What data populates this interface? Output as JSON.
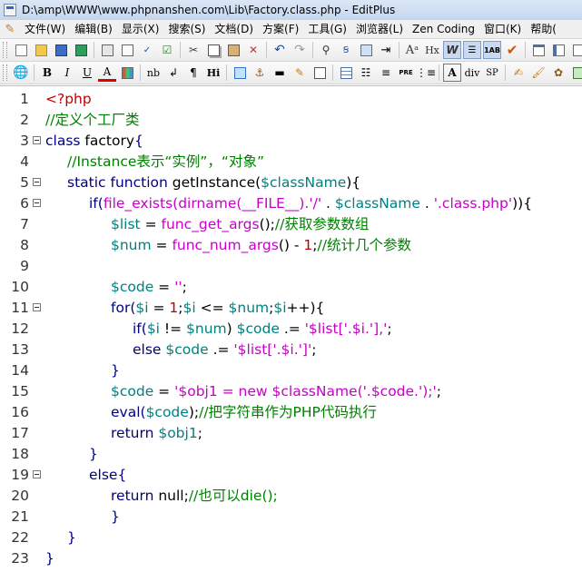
{
  "window": {
    "title": "D:\\amp\\WWW\\www.phpnanshen.com\\Lib\\Factory.class.php - EditPlus"
  },
  "menu": [
    "文件(W)",
    "编辑(B)",
    "显示(X)",
    "搜索(S)",
    "文档(D)",
    "方案(F)",
    "工具(G)",
    "浏览器(L)",
    "Zen Coding",
    "窗口(K)",
    "帮助("
  ],
  "toolbar2": {
    "labels": {
      "bold": "B",
      "italic": "I",
      "underline": "U",
      "fontcolor": "A",
      "nb": "nb",
      "br": "↲",
      "para": "¶",
      "hi": "Hi",
      "pre": "PRE",
      "div": "div",
      "sp": "SP",
      "az": "Aᶻ",
      "hx": "Hx"
    }
  },
  "colors": {
    "keyword": "#000080",
    "variable": "#008080",
    "function": "#c800c8",
    "string": "#c800c8",
    "comment": "#008000",
    "php_tag": "#c00000"
  },
  "lines": [
    {
      "n": "1",
      "fold": false,
      "indent": 0,
      "tokens": [
        [
          "php",
          "<?php"
        ]
      ]
    },
    {
      "n": "2",
      "fold": false,
      "indent": 0,
      "tokens": [
        [
          "cm",
          "//定义个工厂类"
        ]
      ]
    },
    {
      "n": "3",
      "fold": true,
      "indent": 0,
      "tokens": [
        [
          "kw",
          "class "
        ],
        [
          "pl",
          "factory"
        ],
        [
          "kw",
          "{"
        ]
      ]
    },
    {
      "n": "4",
      "fold": false,
      "indent": 1,
      "tokens": [
        [
          "cm",
          "//Instance表示“实例”，“对象”"
        ]
      ]
    },
    {
      "n": "5",
      "fold": true,
      "indent": 1,
      "tokens": [
        [
          "kw",
          "static function "
        ],
        [
          "pl",
          "getInstance("
        ],
        [
          "var",
          "$className"
        ],
        [
          "pl",
          "){"
        ]
      ]
    },
    {
      "n": "6",
      "fold": true,
      "indent": 2,
      "tokens": [
        [
          "kw",
          "if("
        ],
        [
          "fn",
          "file_exists("
        ],
        [
          "fn",
          "dirname("
        ],
        [
          "fn",
          "__FILE__"
        ],
        [
          "fn",
          ")"
        ],
        [
          "str",
          ".'/'"
        ],
        [
          "pl",
          " . "
        ],
        [
          "var",
          "$className"
        ],
        [
          "pl",
          " . "
        ],
        [
          "str",
          "'.class.php'"
        ],
        [
          "pl",
          ")){"
        ]
      ]
    },
    {
      "n": "7",
      "fold": false,
      "indent": 3,
      "tokens": [
        [
          "var",
          "$list"
        ],
        [
          "pl",
          " = "
        ],
        [
          "fn",
          "func_get_args"
        ],
        [
          "pl",
          "();"
        ],
        [
          "cm",
          "//获取参数数组"
        ]
      ]
    },
    {
      "n": "8",
      "fold": false,
      "indent": 3,
      "tokens": [
        [
          "var",
          "$num"
        ],
        [
          "pl",
          " = "
        ],
        [
          "fn",
          "func_num_args"
        ],
        [
          "pl",
          "() - "
        ],
        [
          "num",
          "1"
        ],
        [
          "pl",
          ";"
        ],
        [
          "cm",
          "//统计几个参数"
        ]
      ]
    },
    {
      "n": "9",
      "fold": false,
      "indent": 0,
      "tokens": []
    },
    {
      "n": "10",
      "fold": false,
      "indent": 3,
      "tokens": [
        [
          "var",
          "$code"
        ],
        [
          "pl",
          " = "
        ],
        [
          "str",
          "''"
        ],
        [
          "pl",
          ";"
        ]
      ]
    },
    {
      "n": "11",
      "fold": true,
      "indent": 3,
      "tokens": [
        [
          "kw",
          "for("
        ],
        [
          "var",
          "$i"
        ],
        [
          "pl",
          " = "
        ],
        [
          "num",
          "1"
        ],
        [
          "pl",
          ";"
        ],
        [
          "var",
          "$i"
        ],
        [
          "pl",
          " <= "
        ],
        [
          "var",
          "$num"
        ],
        [
          "pl",
          ";"
        ],
        [
          "var",
          "$i"
        ],
        [
          "pl",
          "++){"
        ]
      ]
    },
    {
      "n": "12",
      "fold": false,
      "indent": 4,
      "tokens": [
        [
          "kw",
          "if("
        ],
        [
          "var",
          "$i"
        ],
        [
          "pl",
          " != "
        ],
        [
          "var",
          "$num"
        ],
        [
          "pl",
          ") "
        ],
        [
          "var",
          "$code"
        ],
        [
          "pl",
          " .= "
        ],
        [
          "str",
          "'$list['.$i.'],'"
        ],
        [
          "pl",
          ";"
        ]
      ]
    },
    {
      "n": "13",
      "fold": false,
      "indent": 4,
      "tokens": [
        [
          "kw",
          "else "
        ],
        [
          "var",
          "$code"
        ],
        [
          "pl",
          " .= "
        ],
        [
          "str",
          "'$list['.$i.']'"
        ],
        [
          "pl",
          ";"
        ]
      ]
    },
    {
      "n": "14",
      "fold": false,
      "indent": 3,
      "tokens": [
        [
          "kw",
          "}"
        ]
      ]
    },
    {
      "n": "15",
      "fold": false,
      "indent": 3,
      "tokens": [
        [
          "var",
          "$code"
        ],
        [
          "pl",
          " = "
        ],
        [
          "str",
          "'$obj1 = new $className('.$code.');'"
        ],
        [
          "pl",
          ";"
        ]
      ]
    },
    {
      "n": "16",
      "fold": false,
      "indent": 3,
      "tokens": [
        [
          "kw",
          "eval("
        ],
        [
          "var",
          "$code"
        ],
        [
          "pl",
          ");"
        ],
        [
          "cm",
          "//把字符串作为PHP代码执行"
        ]
      ]
    },
    {
      "n": "17",
      "fold": false,
      "indent": 3,
      "tokens": [
        [
          "kw",
          "return "
        ],
        [
          "var",
          "$obj1"
        ],
        [
          "pl",
          ";"
        ]
      ]
    },
    {
      "n": "18",
      "fold": false,
      "indent": 2,
      "tokens": [
        [
          "kw",
          "}"
        ]
      ]
    },
    {
      "n": "19",
      "fold": true,
      "indent": 2,
      "tokens": [
        [
          "kw",
          "else{"
        ]
      ]
    },
    {
      "n": "20",
      "fold": false,
      "indent": 3,
      "tokens": [
        [
          "kw",
          "return "
        ],
        [
          "pl",
          "null;"
        ],
        [
          "cm",
          "//也可以die();"
        ]
      ]
    },
    {
      "n": "21",
      "fold": false,
      "indent": 3,
      "tokens": [
        [
          "kw",
          "}"
        ]
      ]
    },
    {
      "n": "22",
      "fold": false,
      "indent": 1,
      "tokens": [
        [
          "kw",
          "}"
        ]
      ]
    },
    {
      "n": "23",
      "fold": false,
      "indent": 0,
      "tokens": [
        [
          "kw",
          "}"
        ]
      ]
    }
  ]
}
